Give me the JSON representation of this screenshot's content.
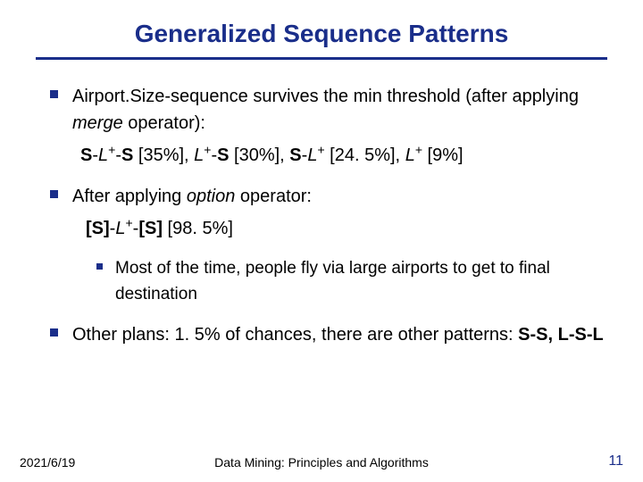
{
  "title": "Generalized Sequence Patterns",
  "bullets": {
    "b1_pre": "Airport.Size-sequence survives the min threshold (after applying ",
    "b1_it": "merge",
    "b1_post": " operator):",
    "line1_html": "<b>S</b>-<em class='it'>L</em><span class='sup'>+</span>-<b>S</b> [35%],  <em class='it'>L</em><span class='sup'>+</span>-<b>S</b> [30%],  <b>S</b>-<em class='it'>L</em><span class='sup'>+</span> [24. 5%],  <em class='it'>L</em><span class='sup'>+</span> [9%]",
    "b2_pre": "After applying ",
    "b2_it": "option",
    "b2_post": " operator:",
    "line2_html": "<b>[S]</b>-<em class='it'>L</em><span class='sup'>+</span>-<b>[S]</b> [98. 5%]",
    "b2a": "Most of the time, people fly via large airports to get to final destination",
    "b3_pre": "Other plans: 1. 5% of chances, there are other patterns: ",
    "b3_bold": "S-S, L-S-L"
  },
  "footer": {
    "date": "2021/6/19",
    "center": "Data Mining: Principles and Algorithms",
    "page": "11"
  }
}
